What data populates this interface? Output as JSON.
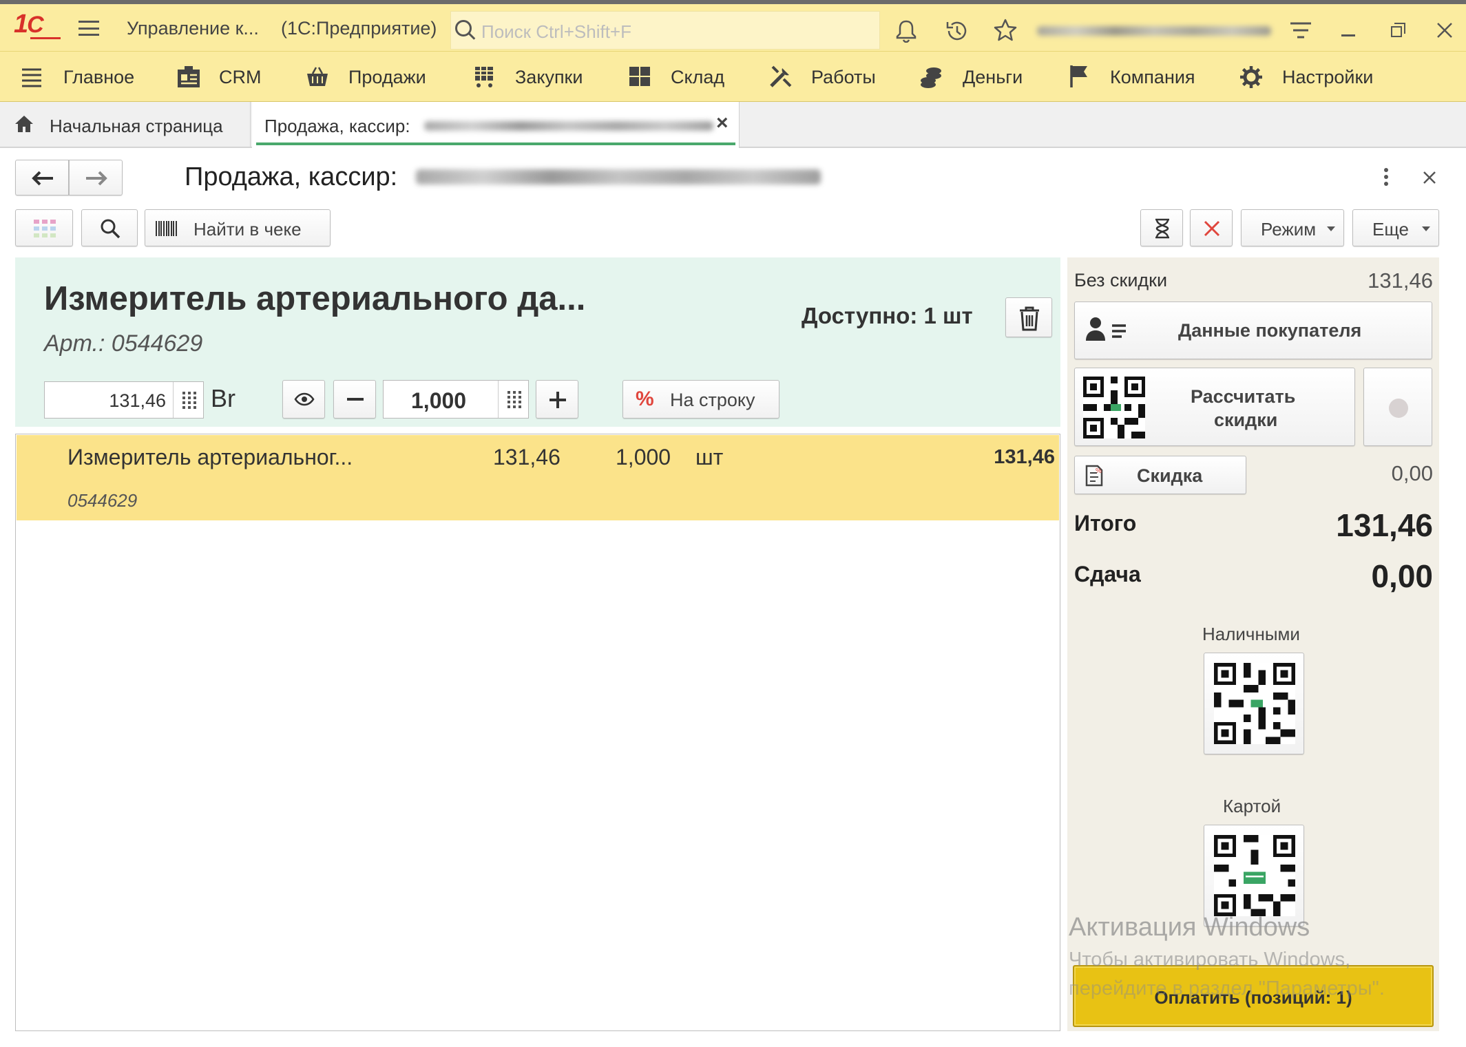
{
  "app": {
    "title": "Управление к...",
    "platform": "(1С:Предприятие)",
    "search_placeholder": "Поиск Ctrl+Shift+F"
  },
  "menu": [
    {
      "label": "Главное",
      "icon": "hamburger-icon"
    },
    {
      "label": "CRM",
      "icon": "crm-card-icon"
    },
    {
      "label": "Продажи",
      "icon": "basket-icon"
    },
    {
      "label": "Закупки",
      "icon": "cart-icon"
    },
    {
      "label": "Склад",
      "icon": "warehouse-icon"
    },
    {
      "label": "Работы",
      "icon": "tools-icon"
    },
    {
      "label": "Деньги",
      "icon": "coins-icon"
    },
    {
      "label": "Компания",
      "icon": "flag-icon"
    },
    {
      "label": "Настройки",
      "icon": "gear-icon"
    }
  ],
  "tabs": {
    "home": "Начальная страница",
    "active": "Продажа, кассир:"
  },
  "form": {
    "title": "Продажа, кассир:",
    "find_in_receipt": "Найти в чеке",
    "mode": "Режим",
    "more": "Еще"
  },
  "product": {
    "name": "Измеритель артериального да...",
    "article": "Арт.: 0544629",
    "available": "Доступно: 1 шт",
    "price": "131,46",
    "currency": "Br",
    "quantity": "1,000",
    "discount_button": "На строку"
  },
  "receipt_lines": [
    {
      "name": "Измеритель артериальног...",
      "code": "0544629",
      "price": "131,46",
      "qty": "1,000",
      "unit": "шт",
      "sum": "131,46"
    }
  ],
  "summary": {
    "no_discount_label": "Без скидки",
    "no_discount_value": "131,46",
    "customer_button": "Данные покупателя",
    "calc_discount_line1": "Рассчитать",
    "calc_discount_line2": "скидки",
    "discount_button": "Скидка",
    "discount_value": "0,00",
    "total_label": "Итого",
    "total_value": "131,46",
    "change_label": "Сдача",
    "change_value": "0,00",
    "cash_label": "Наличными",
    "card_label": "Картой",
    "pay_button": "Оплатить (позиций: 1)"
  },
  "watermark": {
    "line1": "Активация Windows",
    "line2": "Чтобы активировать Windows,",
    "line3": "перейдите в раздел \"Параметры\"."
  },
  "colors": {
    "brand_red": "#d8312a",
    "header_yellow": "#fbeca0",
    "product_panel": "#e5f5ee",
    "selected_row": "#fbe38a",
    "side_panel": "#f2efe6",
    "pay_button": "#e8c214",
    "tab_underline": "#4aa86c"
  }
}
